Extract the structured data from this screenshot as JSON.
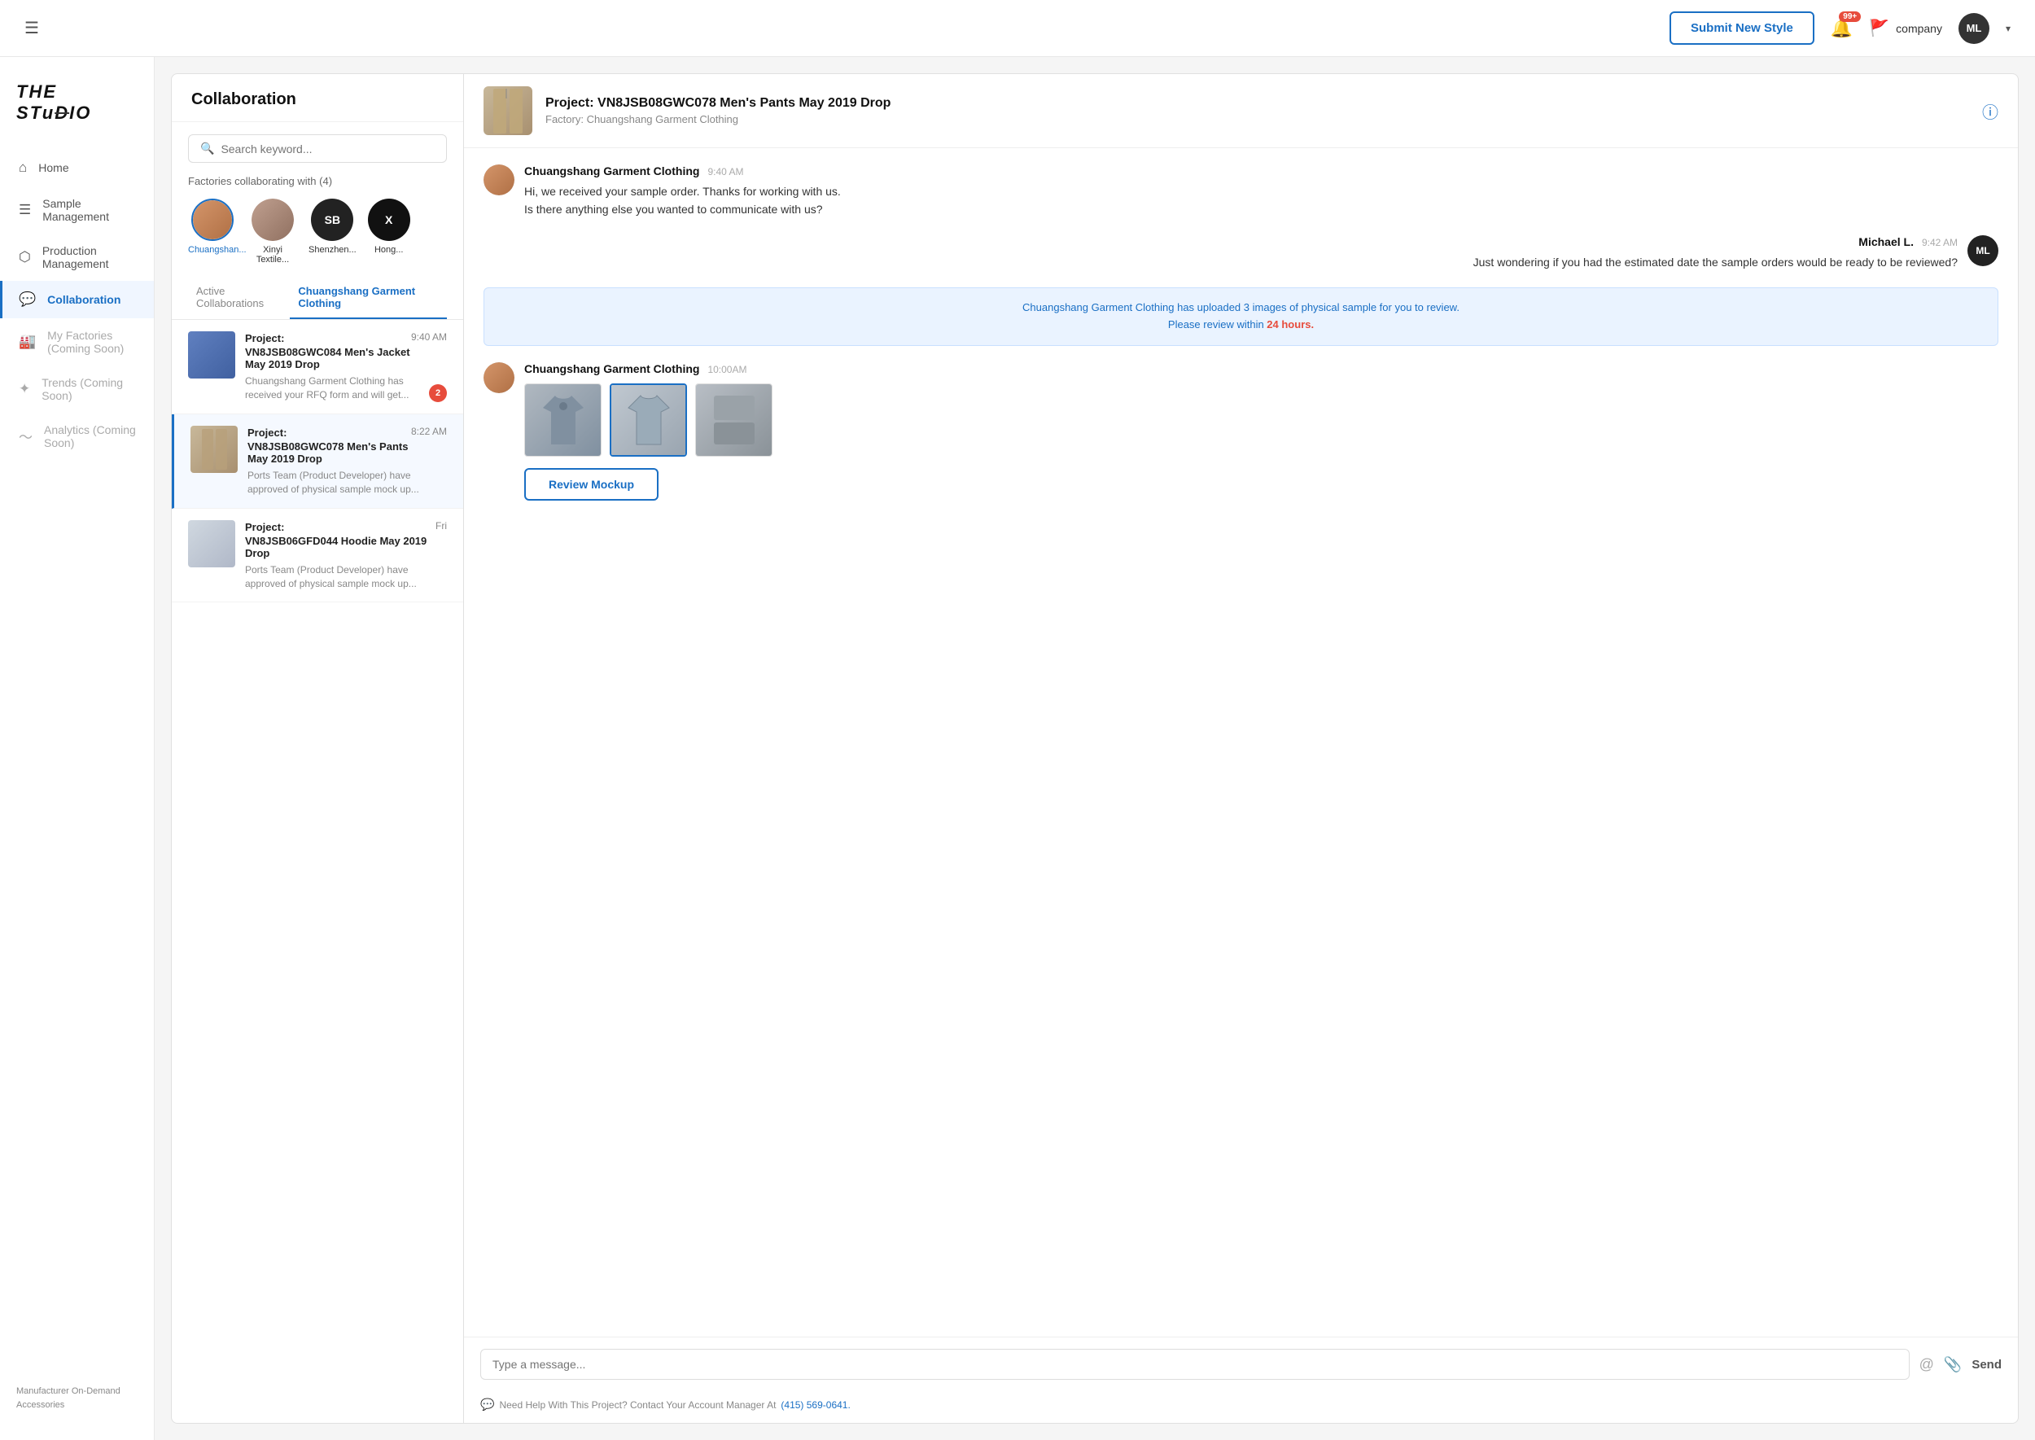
{
  "topbar": {
    "submit_btn": "Submit New Style",
    "notif_badge": "99+",
    "brand_name": "company",
    "avatar_initials": "ML",
    "hamburger": "☰"
  },
  "sidebar": {
    "logo_line1": "THE",
    "logo_line2": "STuDIO",
    "items": [
      {
        "id": "home",
        "label": "Home",
        "icon": "⌂"
      },
      {
        "id": "sample-management",
        "label": "Sample Management",
        "icon": "☰"
      },
      {
        "id": "production-management",
        "label": "Production Management",
        "icon": "⬡"
      },
      {
        "id": "collaboration",
        "label": "Collaboration",
        "icon": "💬",
        "active": true
      },
      {
        "id": "my-factories",
        "label": "My Factories (Coming Soon)",
        "icon": "🏭",
        "comingSoon": true
      },
      {
        "id": "trends",
        "label": "Trends (Coming Soon)",
        "icon": "✦",
        "comingSoon": true
      },
      {
        "id": "analytics",
        "label": "Analytics (Coming Soon)",
        "icon": "📈",
        "comingSoon": true
      }
    ],
    "footer": "Manufacturer On-Demand Accessories"
  },
  "collab_panel": {
    "title": "Collaboration",
    "search_placeholder": "Search keyword...",
    "factories_label": "Factories collaborating with (4)",
    "factories": [
      {
        "name": "Chuangshan...",
        "initials": "",
        "color": "photo1",
        "selected": true
      },
      {
        "name": "Xinyi Textile...",
        "initials": "",
        "color": "photo2"
      },
      {
        "name": "Shenzhen...",
        "initials": "SB",
        "color": "dark"
      },
      {
        "name": "Hong...",
        "initials": "X",
        "color": "black"
      }
    ],
    "tabs": [
      {
        "label": "Active Collaborations",
        "active": false
      },
      {
        "label": "Chuangshang Garment Clothing",
        "active": true
      }
    ],
    "list_items": [
      {
        "id": "item1",
        "project_label": "Project:",
        "project_name": "VN8JSB08GWC084 Men's Jacket May 2019 Drop",
        "time": "9:40 AM",
        "description": "Chuangshang Garment Clothing has received your RFQ form and will get...",
        "badge": "2",
        "selected": false,
        "thumb_type": "jacket"
      },
      {
        "id": "item2",
        "project_label": "Project:",
        "project_name": "VN8JSB08GWC078 Men's Pants May 2019 Drop",
        "time": "8:22 AM",
        "description": "Ports Team (Product Developer) have approved of physical sample mock up...",
        "badge": "",
        "selected": true,
        "thumb_type": "pants"
      },
      {
        "id": "item3",
        "project_label": "Project:",
        "project_name": "VN8JSB06GFD044 Hoodie May 2019 Drop",
        "time": "Fri",
        "description": "Ports Team (Product Developer) have approved of physical sample mock up...",
        "badge": "",
        "selected": false,
        "thumb_type": "hoodie"
      }
    ]
  },
  "chat_panel": {
    "header_title": "Project: VN8JSB08GWC078 Men's Pants May 2019 Drop",
    "header_sub": "Factory: Chuangshang Garment Clothing",
    "messages": [
      {
        "id": "msg1",
        "sender": "Chuangshang Garment Clothing",
        "time": "9:40 AM",
        "text": "Hi, we received your sample order. Thanks for working with us.\nIs there anything else you wanted to communicate with us?",
        "type": "factory"
      },
      {
        "id": "msg2",
        "sender": "Michael L.",
        "time": "9:42 AM",
        "text": "Just wondering if you had the estimated date the sample orders would be ready to be reviewed?",
        "type": "user",
        "initials": "ML"
      }
    ],
    "alert": {
      "text_before": "Chuangshang Garment Clothing has uploaded 3 images of physical sample for you to review.",
      "text_mid": "Please review within ",
      "urgent": "24 hours.",
      "text_after": ""
    },
    "sample_msg": {
      "sender": "Chuangshang Garment Clothing",
      "time": "10:00AM"
    },
    "review_btn": "Review Mockup",
    "input_placeholder": "Type a message...",
    "send_label": "Send",
    "footer_text": "Need Help With This Project? Contact Your Account Manager At",
    "footer_phone": "(415) 569-0641."
  }
}
